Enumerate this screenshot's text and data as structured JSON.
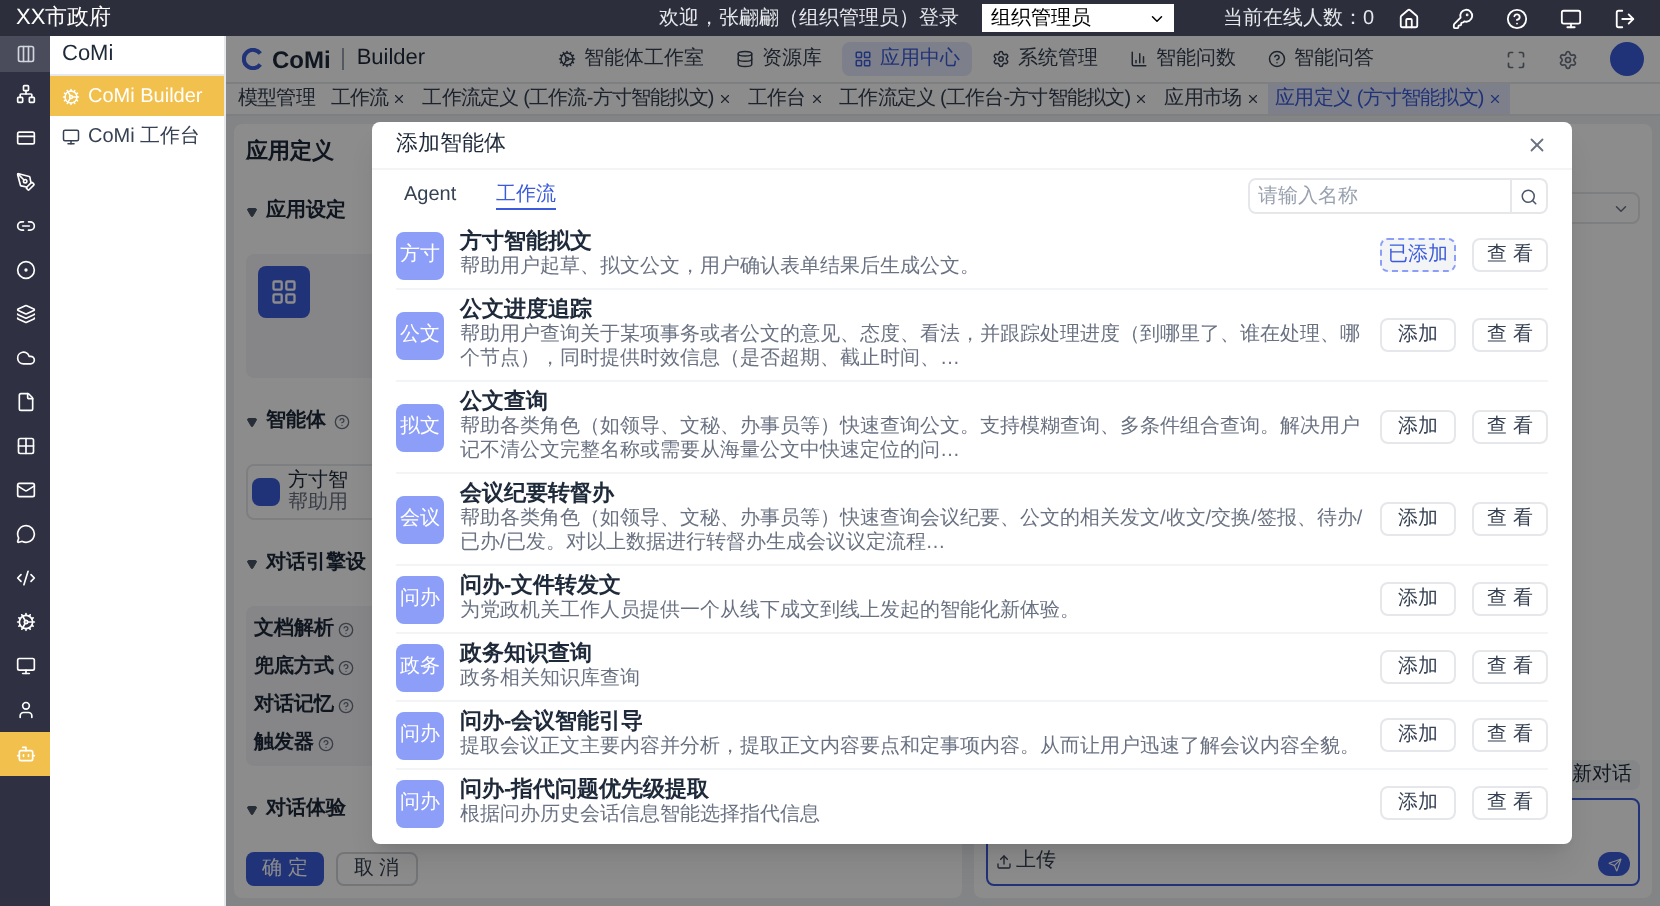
{
  "top_bar": {
    "title": "XX市政府",
    "welcome": "欢迎，张翩翩（组织管理员）登录",
    "role_select": "组织管理员",
    "online": "当前在线人数：0"
  },
  "rail": [
    {
      "selected": false
    },
    {
      "selected": false
    },
    {
      "selected": false
    },
    {
      "selected": false
    },
    {
      "selected": false
    },
    {
      "selected": false
    },
    {
      "selected": false
    },
    {
      "selected": false
    },
    {
      "selected": false
    },
    {
      "selected": false
    },
    {
      "selected": false
    },
    {
      "selected": false
    },
    {
      "selected": false
    },
    {
      "selected": false
    },
    {
      "selected": false
    },
    {
      "selected": true
    }
  ],
  "sidebar": {
    "title": "CoMi",
    "items": [
      {
        "label": "CoMi Builder",
        "selected": true
      },
      {
        "label": "CoMi 工作台",
        "selected": false
      }
    ]
  },
  "header": {
    "logo": "CoMi",
    "product": "Builder",
    "nav": [
      {
        "label": "智能体工作室",
        "selected": false
      },
      {
        "label": "资源库",
        "selected": false
      },
      {
        "label": "应用中心",
        "selected": true
      },
      {
        "label": "系统管理",
        "selected": false
      },
      {
        "label": "智能问数",
        "selected": false
      },
      {
        "label": "智能问答",
        "selected": false
      }
    ]
  },
  "tabs": [
    {
      "label": "模型管理",
      "closable": false,
      "selected": false
    },
    {
      "label": "工作流",
      "closable": true,
      "selected": false
    },
    {
      "label": "工作流定义 (工作流-方寸智能拟文)",
      "closable": true,
      "selected": false
    },
    {
      "label": "工作台",
      "closable": true,
      "selected": false
    },
    {
      "label": "工作流定义 (工作台-方寸智能拟文)",
      "closable": true,
      "selected": false
    },
    {
      "label": "应用市场",
      "closable": true,
      "selected": false
    },
    {
      "label": "应用定义 (方寸智能拟文)",
      "closable": true,
      "selected": true
    }
  ],
  "page": {
    "title": "应用定义",
    "app_settings": "应用设定",
    "agents": "智能体",
    "agent_chip": {
      "title": "方寸智",
      "desc": "帮助用"
    },
    "engine": "对话引擎设",
    "engine_fields": [
      "文档解析",
      "兜底方式",
      "对话记忆",
      "触发器"
    ],
    "experience": "对话体验",
    "confirm": "确 定",
    "cancel": "取 消"
  },
  "chat": {
    "new_chat": "新对话",
    "upload": "上传"
  },
  "modal": {
    "title": "添加智能体",
    "tabs": [
      {
        "label": "Agent",
        "selected": false
      },
      {
        "label": "工作流",
        "selected": true
      }
    ],
    "search_placeholder": "请输入名称",
    "items": [
      {
        "badge": "方寸",
        "title": "方寸智能拟文",
        "desc": "帮助用户起草、拟文公文，用户确认表单结果后生成公文。",
        "added": true,
        "action": "已添加",
        "view": "查 看"
      },
      {
        "badge": "公文",
        "title": "公文进度追踪",
        "desc": "帮助用户查询关于某项事务或者公文的意见、态度、看法，并跟踪处理进度（到哪里了、谁在处理、哪个节点），同时提供时效信息（是否超期、截止时间、…",
        "added": false,
        "action": "添加",
        "view": "查 看"
      },
      {
        "badge": "拟文",
        "title": "公文查询",
        "desc": "帮助各类角色（如领导、文秘、办事员等）快速查询公文。支持模糊查询、多条件组合查询。解决用户记不清公文完整名称或需要从海量公文中快速定位的问…",
        "added": false,
        "action": "添加",
        "view": "查 看"
      },
      {
        "badge": "会议",
        "title": "会议纪要转督办",
        "desc": "帮助各类角色（如领导、文秘、办事员等）快速查询会议纪要、公文的相关发文/收文/交换/签报、待办/已办/已发。对以上数据进行转督办生成会议议定流程…",
        "added": false,
        "action": "添加",
        "view": "查 看"
      },
      {
        "badge": "问办",
        "title": "问办-文件转发文",
        "desc": "为党政机关工作人员提供一个从线下成文到线上发起的智能化新体验。",
        "added": false,
        "action": "添加",
        "view": "查 看"
      },
      {
        "badge": "政务",
        "title": "政务知识查询",
        "desc": "政务相关知识库查询",
        "added": false,
        "action": "添加",
        "view": "查 看"
      },
      {
        "badge": "问办",
        "title": "问办-会议智能引导",
        "desc": "提取会议正文主要内容并分析，提取正文内容要点和定事项内容。从而让用户迅速了解会议内容全貌。",
        "added": false,
        "action": "添加",
        "view": "查 看"
      },
      {
        "badge": "问办",
        "title": "问办-指代问题优先级提取",
        "desc": "根据问办历史会话信息智能选择指代信息",
        "added": false,
        "action": "添加",
        "view": "查 看"
      }
    ]
  }
}
